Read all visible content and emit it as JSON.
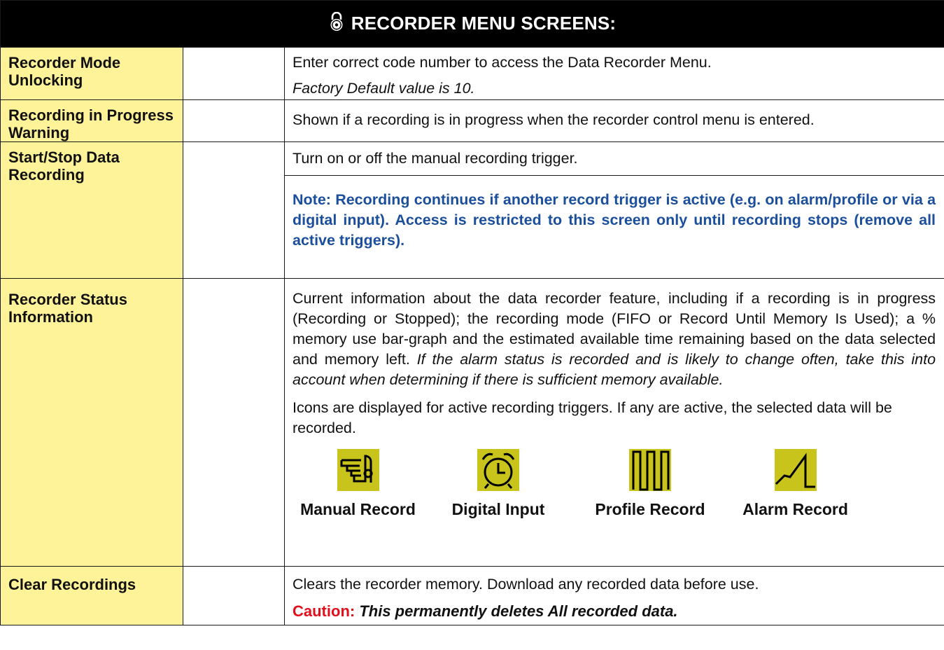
{
  "header": {
    "title": "RECORDER MENU SCREENS:"
  },
  "rows": [
    {
      "label": "Recorder Mode Unlocking",
      "desc": "Enter correct code number to access the Data Recorder Menu.",
      "note_italic": "Factory Default value is 10."
    },
    {
      "label": "Recording in Progress Warning",
      "desc": "Shown if a recording is in progress when the recorder control menu is entered."
    },
    {
      "label": "Start/Stop Data Recording",
      "desc": "Turn on or off the manual recording trigger.",
      "note": "Note: Recording continues if another record trigger is active (e.g. on alarm/profile or via a digital input). Access is restricted to this screen only until recording stops (remove all active triggers)."
    },
    {
      "label": "Recorder Status Information",
      "desc": "Current information about the data recorder feature, including if a recording is in progress (Recording or Stopped); the recording mode (FIFO or Record Until Memory Is Used); a % memory use bar-graph and the estimated available time remaining based on the data selected and memory left.",
      "desc_italic": "If the alarm status is recorded and is likely to change often, take this into account when determining if there is sufficient memory available.",
      "desc2": "Icons are displayed for active recording triggers. If any are active, the selected data will be recorded.",
      "icons": [
        {
          "label": "Manual Record",
          "icon": "manual-record-icon"
        },
        {
          "label": "Digital Input",
          "icon": "digital-input-clock-icon"
        },
        {
          "label": "Profile Record",
          "icon": "profile-record-icon"
        },
        {
          "label": "Alarm Record",
          "icon": "alarm-record-icon"
        }
      ]
    },
    {
      "label": "Clear Recordings",
      "desc": "Clears the recorder memory. Download any recorded data before use.",
      "caution_label": "Caution:",
      "caution_text": "This permanently deletes All recorded data."
    }
  ],
  "colors": {
    "header_bg": "#000000",
    "label_bg": "#fff39a",
    "note": "#1b4f9c",
    "caution": "#e0111d",
    "icon_bg": "#c8c41c"
  }
}
